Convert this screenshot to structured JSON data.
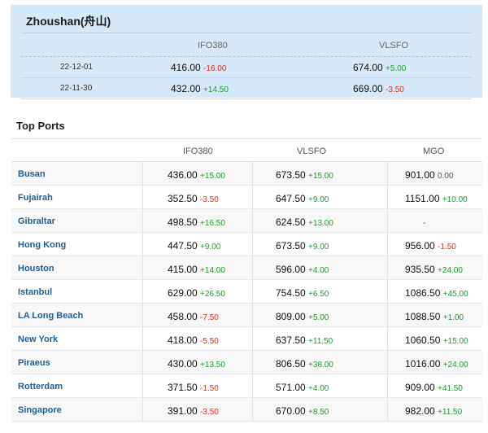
{
  "zhoushan": {
    "title": "Zhoushan(舟山)",
    "columns": [
      "IFO380",
      "VLSFO"
    ],
    "rows": [
      {
        "date": "22-12-01",
        "ifo380": {
          "price": "416.00",
          "change": "-16.00"
        },
        "vlsfo": {
          "price": "674.00",
          "change": "+5.00"
        }
      },
      {
        "date": "22-11-30",
        "ifo380": {
          "price": "432.00",
          "change": "+14.50"
        },
        "vlsfo": {
          "price": "669.00",
          "change": "-3.50"
        }
      }
    ]
  },
  "top_ports": {
    "title": "Top Ports",
    "columns": [
      "IFO380",
      "VLSFO",
      "MGO"
    ],
    "rows": [
      {
        "port": "Busan",
        "ifo380": {
          "price": "436.00",
          "change": "+15.00"
        },
        "vlsfo": {
          "price": "673.50",
          "change": "+15.00"
        },
        "mgo": {
          "price": "901.00",
          "change": "0.00"
        }
      },
      {
        "port": "Fujairah",
        "ifo380": {
          "price": "352.50",
          "change": "-3.50"
        },
        "vlsfo": {
          "price": "647.50",
          "change": "+9.00"
        },
        "mgo": {
          "price": "1151.00",
          "change": "+10.00"
        }
      },
      {
        "port": "Gibraltar",
        "ifo380": {
          "price": "498.50",
          "change": "+16.50"
        },
        "vlsfo": {
          "price": "624.50",
          "change": "+13.00"
        },
        "mgo": {
          "price": "",
          "change": "-"
        }
      },
      {
        "port": "Hong Kong",
        "ifo380": {
          "price": "447.50",
          "change": "+9.00"
        },
        "vlsfo": {
          "price": "673.50",
          "change": "+9.00"
        },
        "mgo": {
          "price": "956.00",
          "change": "-1.50"
        }
      },
      {
        "port": "Houston",
        "ifo380": {
          "price": "415.00",
          "change": "+14.00"
        },
        "vlsfo": {
          "price": "596.00",
          "change": "+4.00"
        },
        "mgo": {
          "price": "935.50",
          "change": "+24.00"
        }
      },
      {
        "port": "Istanbul",
        "ifo380": {
          "price": "629.00",
          "change": "+26.50"
        },
        "vlsfo": {
          "price": "754.50",
          "change": "+6.50"
        },
        "mgo": {
          "price": "1086.50",
          "change": "+45.00"
        }
      },
      {
        "port": "LA Long Beach",
        "ifo380": {
          "price": "458.00",
          "change": "-7.50"
        },
        "vlsfo": {
          "price": "809.00",
          "change": "+5.00"
        },
        "mgo": {
          "price": "1088.50",
          "change": "+1.00"
        }
      },
      {
        "port": "New York",
        "ifo380": {
          "price": "418.00",
          "change": "-5.50"
        },
        "vlsfo": {
          "price": "637.50",
          "change": "+11.50"
        },
        "mgo": {
          "price": "1060.50",
          "change": "+15.00"
        }
      },
      {
        "port": "Piraeus",
        "ifo380": {
          "price": "430.00",
          "change": "+13.50"
        },
        "vlsfo": {
          "price": "806.50",
          "change": "+38.00"
        },
        "mgo": {
          "price": "1016.00",
          "change": "+24.00"
        }
      },
      {
        "port": "Rotterdam",
        "ifo380": {
          "price": "371.50",
          "change": "-1.50"
        },
        "vlsfo": {
          "price": "571.00",
          "change": "+4.00"
        },
        "mgo": {
          "price": "909.00",
          "change": "+41.50"
        }
      },
      {
        "port": "Singapore",
        "ifo380": {
          "price": "391.00",
          "change": "-3.50"
        },
        "vlsfo": {
          "price": "670.00",
          "change": "+8.50"
        },
        "mgo": {
          "price": "982.00",
          "change": "+11.50"
        }
      }
    ]
  },
  "colors": {
    "positive": "#1c9c2c",
    "negative": "#e32a1f",
    "port_link": "#1f5f95",
    "card_bg": "#d5e9f8"
  }
}
